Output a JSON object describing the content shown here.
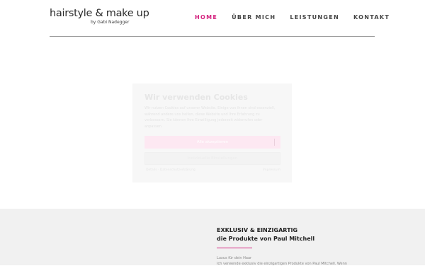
{
  "header": {
    "logo_main": "hairstyle & make up",
    "logo_sub": "by Gabi Nadegger",
    "nav": [
      {
        "label": "HOME",
        "active": true
      },
      {
        "label": "ÜBER MICH",
        "active": false
      },
      {
        "label": "LEISTUNGEN",
        "active": false
      },
      {
        "label": "KONTAKT",
        "active": false
      }
    ]
  },
  "cookie_banner": {
    "title": "Wir verwenden Cookies",
    "text": "Wir nutzen Cookies auf unserer Website. Einige von ihnen sind essenziell, während andere uns helfen, diese Website und Ihre Erfahrung zu verbessern. Sie können Ihre Einwilligung jederzeit widerrufen oder anpassen.",
    "accept_label": "Alle akzeptieren",
    "settings_label": "Individuelle Einstellungen",
    "link_left": "Details · Datenschutzerklärung",
    "link_right": "Impressum"
  },
  "feature": {
    "heading_line1": "EXKLUSIV & EINZIGARTIG",
    "heading_line2": "die Produkte von Paul Mitchell",
    "kicker": "Luxus für dein Haar",
    "text": "Ich verwende exklusiv die einzigartigen Produkte von Paul Mitchell. Wenn"
  },
  "colors": {
    "accent": "#d4237f",
    "footer_bg": "#f1f1f1"
  }
}
